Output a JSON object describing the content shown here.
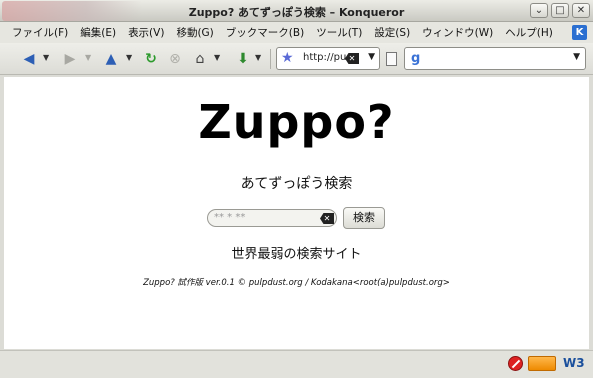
{
  "window": {
    "title": "Zuppo? あてずっぽう検索 – Konqueror",
    "buttons": [
      "⌄",
      "□",
      "✕"
    ]
  },
  "menu": {
    "items": [
      "ファイル(F)",
      "編集(E)",
      "表示(V)",
      "移動(G)",
      "ブックマーク(B)",
      "ツール(T)",
      "設定(S)",
      "ウィンドウ(W)",
      "ヘルプ(H)"
    ]
  },
  "toolbar": {
    "url_text": "http://pu",
    "icons": [
      "back-icon",
      "forward-icon",
      "up-icon",
      "reload-icon",
      "stop-icon",
      "home-icon",
      "download-icon"
    ]
  },
  "page": {
    "title": "Zuppo?",
    "subtitle": "あてずっぽう検索",
    "search_placeholder": "** * **",
    "search_button": "検索",
    "tagline": "世界最弱の検索サイト",
    "footer": "Zuppo? 試作版 ver.0.1 © pulpdust.org / Kodakana<root(a)pulpdust.org>"
  },
  "statusbar": {
    "w3_label": "W3"
  }
}
